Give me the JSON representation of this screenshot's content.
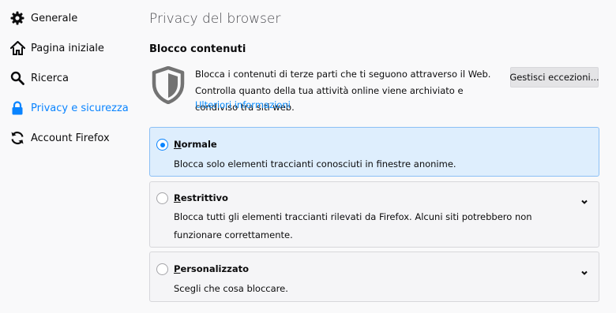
{
  "sidebar": {
    "items": [
      {
        "label": "Generale",
        "icon": "gear-icon"
      },
      {
        "label": "Pagina iniziale",
        "icon": "home-icon"
      },
      {
        "label": "Ricerca",
        "icon": "search-icon"
      },
      {
        "label": "Privacy e sicurezza",
        "icon": "lock-icon",
        "selected": true
      },
      {
        "label": "Account Firefox",
        "icon": "sync-icon"
      }
    ]
  },
  "main": {
    "title": "Privacy del browser",
    "section_title": "Blocco contenuti",
    "description": "Blocca i contenuti di terze parti che ti seguono attraverso il Web. Controlla quanto della tua attività online viene archiviato e condiviso tra siti web.",
    "learn_more": "Ulteriori informazioni",
    "exceptions_button": "Gestisci eccezioni...",
    "options": [
      {
        "title_key": "N",
        "title_rest": "ormale",
        "description": "Blocca solo elementi traccianti conosciuti in finestre anonime.",
        "selected": true
      },
      {
        "title_key": "R",
        "title_rest": "estrittivo",
        "description": "Blocca tutti gli elementi traccianti rilevati da Firefox. Alcuni siti potrebbero non funzionare correttamente.",
        "selected": false
      },
      {
        "title_key": "P",
        "title_rest": "ersonalizzato",
        "description": "Scegli che cosa bloccare.",
        "selected": false
      }
    ]
  },
  "colors": {
    "accent": "#0a84ff",
    "selected_bg": "#deeefd",
    "link": "#0a8dff"
  }
}
